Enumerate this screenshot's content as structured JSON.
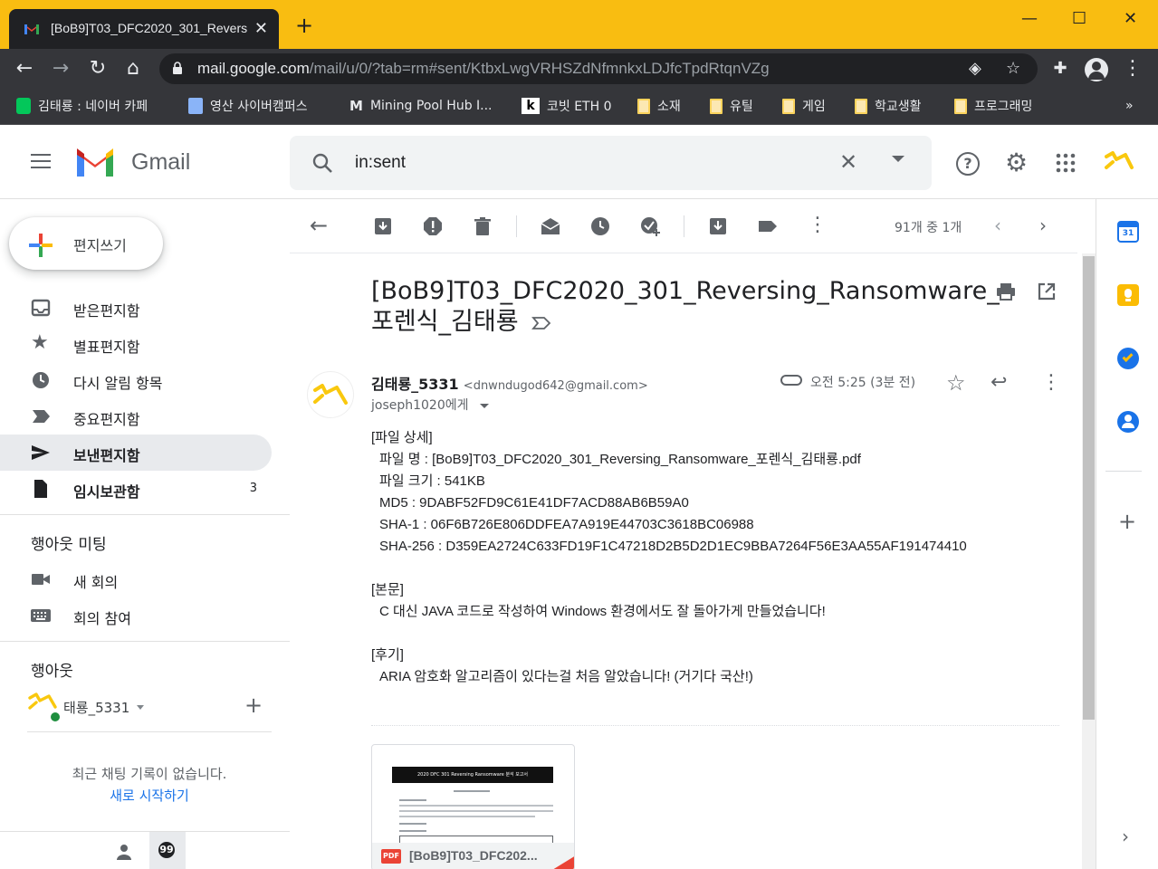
{
  "browser": {
    "tab_title": "[BoB9]T03_DFC2020_301_Revers",
    "url_host": "mail.google.com",
    "url_path": "/mail/u/0/?tab=rm#sent/KtbxLwgVRHSZdNfmnkxLDJfcTpdRtqnVZg",
    "bookmarks": [
      {
        "label": "김태룡 : 네이버 카페",
        "icon": "naver-cafe-icon"
      },
      {
        "label": "영산 사이버캠퍼스",
        "icon": "notepad-icon"
      },
      {
        "label": "Mining Pool Hub I...",
        "icon": "m-logo-icon"
      },
      {
        "label": "코빗 ETH 0",
        "icon": "k-logo-icon"
      },
      {
        "label": "소재",
        "icon": "folder-icon"
      },
      {
        "label": "유틸",
        "icon": "folder-icon"
      },
      {
        "label": "게임",
        "icon": "folder-icon"
      },
      {
        "label": "학교생활",
        "icon": "folder-icon"
      },
      {
        "label": "프로그래밍",
        "icon": "folder-icon"
      }
    ],
    "more_bookmarks": "»",
    "accent": "#f9bd11"
  },
  "gmail": {
    "app_name": "Gmail",
    "search_query": "in:sent",
    "compose_label": "편지쓰기",
    "nav": [
      {
        "label": "받은편지함",
        "icon": "inbox-icon"
      },
      {
        "label": "별표편지함",
        "icon": "star-icon"
      },
      {
        "label": "다시 알림 항목",
        "icon": "clock-icon"
      },
      {
        "label": "중요편지함",
        "icon": "important-icon"
      },
      {
        "label": "보낸편지함",
        "icon": "send-icon"
      },
      {
        "label": "임시보관함",
        "icon": "draft-icon",
        "count": "3"
      }
    ],
    "meet_heading": "행아웃 미팅",
    "meet_items": [
      {
        "label": "새 회의",
        "icon": "video-icon"
      },
      {
        "label": "회의 참여",
        "icon": "keyboard-icon"
      }
    ],
    "hangouts_heading": "행아웃",
    "hangouts_user": "태룡_5331",
    "no_chats": "최근 채팅 기록이 없습니다.",
    "start_chat": "새로 시작하기",
    "pager": "91개 중 1개"
  },
  "message": {
    "subject": "[BoB9]T03_DFC2020_301_Reversing_Ransomware_포렌식_김태룡",
    "sender_name": "김태룡_5331",
    "sender_email": "<dnwndugod642@gmail.com>",
    "to": "joseph1020에게",
    "time": "오전 5:25 (3분 전)",
    "body": {
      "h1": "[파일 상세]",
      "file_name": "파일 명 : [BoB9]T03_DFC2020_301_Reversing_Ransomware_포렌식_김태룡.pdf",
      "file_size": "파일 크기 : 541KB",
      "md5": "MD5 : 9DABF52FD9C61E41DF7ACD88AB6B59A0",
      "sha1": "SHA-1 : 06F6B726E806DDFEA7A919E44703C3618BC06988",
      "sha256": "SHA-256 : D359EA2724C633FD19F1C47218D2B5D2D1EC9BBA7264F56E3AA55AF191474410",
      "h2": "[본문]",
      "main_text": "C 대신 JAVA 코드로 작성하여 Windows 환경에서도 잘 돌아가게 만들었습니다!",
      "h3": "[후기]",
      "review": "ARIA 암호화 알고리즘이 있다는걸 처음 알았습니다! (거기다 국산!)"
    },
    "attachment": {
      "thumb_title": "2020 DFC 301 Reversing Ransomware 분석 보고서",
      "file_name": "[BoB9]T03_DFC202...",
      "type_label": "PDF"
    }
  }
}
